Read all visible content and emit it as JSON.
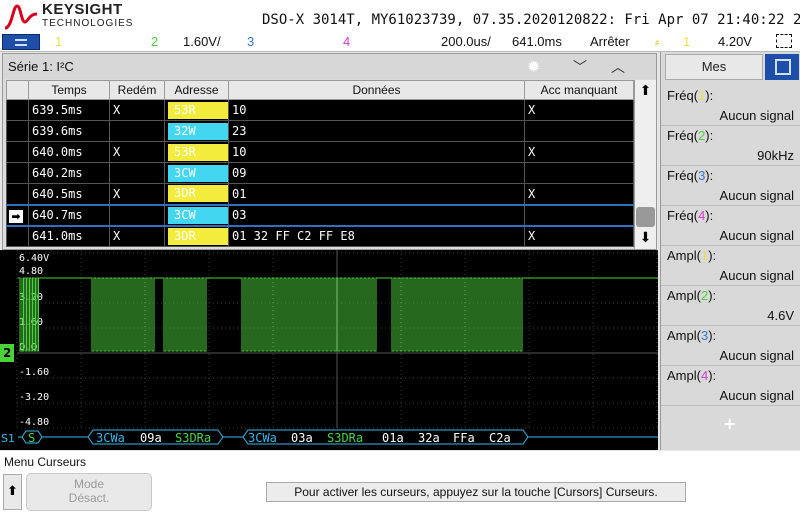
{
  "header": {
    "brand": "KEYSIGHT",
    "brand_sub": "TECHNOLOGIES",
    "model_line": "DSO-X 3014T, MY61023739, 07.35.2020120822: Fri Apr 07 21:40:22 2023"
  },
  "channels": {
    "ch1": "1",
    "ch2": "2",
    "ch2_scale": "1.60V/",
    "ch3": "3",
    "ch4": "4",
    "timebase": "200.0us/",
    "delay": "641.0ms",
    "run_state": "Arrêter",
    "trigger_ch": "1",
    "trigger_level": "4.20V",
    "colors": {
      "ch1": "#e8e04a",
      "ch2": "#4bd23b",
      "ch3": "#3a74d6",
      "ch4": "#d43bd0",
      "trigger": "#e8c400"
    }
  },
  "lister": {
    "title": "Série 1: I²C",
    "columns": [
      "Temps",
      "Redém",
      "Adresse",
      "Données",
      "Acc manquant"
    ],
    "rows": [
      {
        "time": "639.5ms",
        "restart": "X",
        "address": "53R",
        "address_color": "yellow",
        "data": "10",
        "missing_ack": "X",
        "time_color": "white"
      },
      {
        "time": "639.6ms",
        "restart": "",
        "address": "32W",
        "address_color": "cyan",
        "data": "23",
        "missing_ack": "",
        "time_color": "white"
      },
      {
        "time": "640.0ms",
        "restart": "X",
        "address": "53R",
        "address_color": "yellow",
        "data": "10",
        "missing_ack": "X",
        "time_color": "blue"
      },
      {
        "time": "640.2ms",
        "restart": "",
        "address": "3CW",
        "address_color": "cyan",
        "data": "09",
        "missing_ack": "",
        "time_color": "blue"
      },
      {
        "time": "640.5ms",
        "restart": "X",
        "address": "3DR",
        "address_color": "yellow",
        "data": "01",
        "missing_ack": "X",
        "time_color": "blue"
      },
      {
        "time": "640.7ms",
        "restart": "",
        "address": "3CW",
        "address_color": "cyan",
        "data": "03",
        "missing_ack": "",
        "time_color": "blue"
      },
      {
        "time": "641.0ms",
        "restart": "X",
        "address": "3DR",
        "address_color": "yellow",
        "data": "01 32 FF C2 FF E8",
        "missing_ack": "X",
        "time_color": "blue"
      }
    ]
  },
  "waveform": {
    "y_ticks": [
      "6.40V",
      "4.80",
      "3.20",
      "1.60",
      "0.0",
      "-1.60",
      "-3.20",
      "-4.80"
    ],
    "channel_marker": "2",
    "serial_label": "S1",
    "decode": [
      {
        "text": "S",
        "color": "#49d44a"
      },
      {
        "text": "3CWa",
        "color": "#39b8e8"
      },
      {
        "text": "09a",
        "color": "#ffffff"
      },
      {
        "text": "S3DRa",
        "color": "#49d44a"
      },
      {
        "text": "3CWa",
        "color": "#39b8e8"
      },
      {
        "text": "03a",
        "color": "#ffffff"
      },
      {
        "text": "S3DRa",
        "color": "#49d44a"
      },
      {
        "text": "01a",
        "color": "#ffffff"
      },
      {
        "text": "32a",
        "color": "#ffffff"
      },
      {
        "text": "FFa",
        "color": "#ffffff"
      },
      {
        "text": "C2a",
        "color": "#ffffff"
      }
    ]
  },
  "measurements": {
    "tab": "Mes",
    "items": [
      {
        "name": "Fréq",
        "ch": "1",
        "value": "Aucun signal",
        "color": "#e8e04a"
      },
      {
        "name": "Fréq",
        "ch": "2",
        "value": "90kHz",
        "color": "#4bd23b"
      },
      {
        "name": "Fréq",
        "ch": "3",
        "value": "Aucun signal",
        "color": "#3a74d6"
      },
      {
        "name": "Fréq",
        "ch": "4",
        "value": "Aucun signal",
        "color": "#d43bd0"
      },
      {
        "name": "Ampl",
        "ch": "1",
        "value": "Aucun signal",
        "color": "#e8e04a"
      },
      {
        "name": "Ampl",
        "ch": "2",
        "value": "4.6V",
        "color": "#4bd23b"
      },
      {
        "name": "Ampl",
        "ch": "3",
        "value": "Aucun signal",
        "color": "#3a74d6"
      },
      {
        "name": "Ampl",
        "ch": "4",
        "value": "Aucun signal",
        "color": "#d43bd0"
      }
    ]
  },
  "softkeys": {
    "menu_title": "Menu Curseurs",
    "mode_label": "Mode",
    "mode_value": "Désact.",
    "hint": "Pour activer les curseurs, appuyez sur la touche [Cursors] Curseurs."
  }
}
